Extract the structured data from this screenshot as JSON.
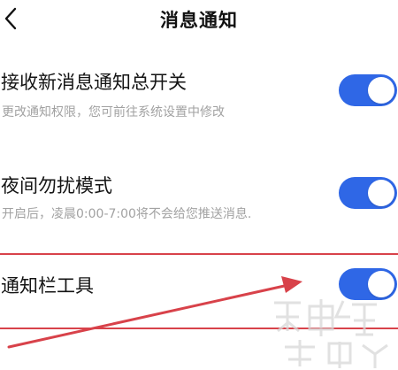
{
  "header": {
    "title": "消息通知",
    "back_icon": "chevron-left-icon"
  },
  "settings": [
    {
      "title": "接收新消息通知总开关",
      "description": "更改通知权限，您可前往系统设置中修改",
      "enabled": true
    },
    {
      "title": "夜间勿扰模式",
      "description": "开启后，凌晨0:00-7:00将不会给您推送消息.",
      "enabled": true
    },
    {
      "title": "通知栏工具",
      "description": "",
      "enabled": true
    }
  ],
  "colors": {
    "toggle_on": "#2f67e6",
    "annotation": "#d8424a",
    "description_text": "#a2a2a2"
  }
}
